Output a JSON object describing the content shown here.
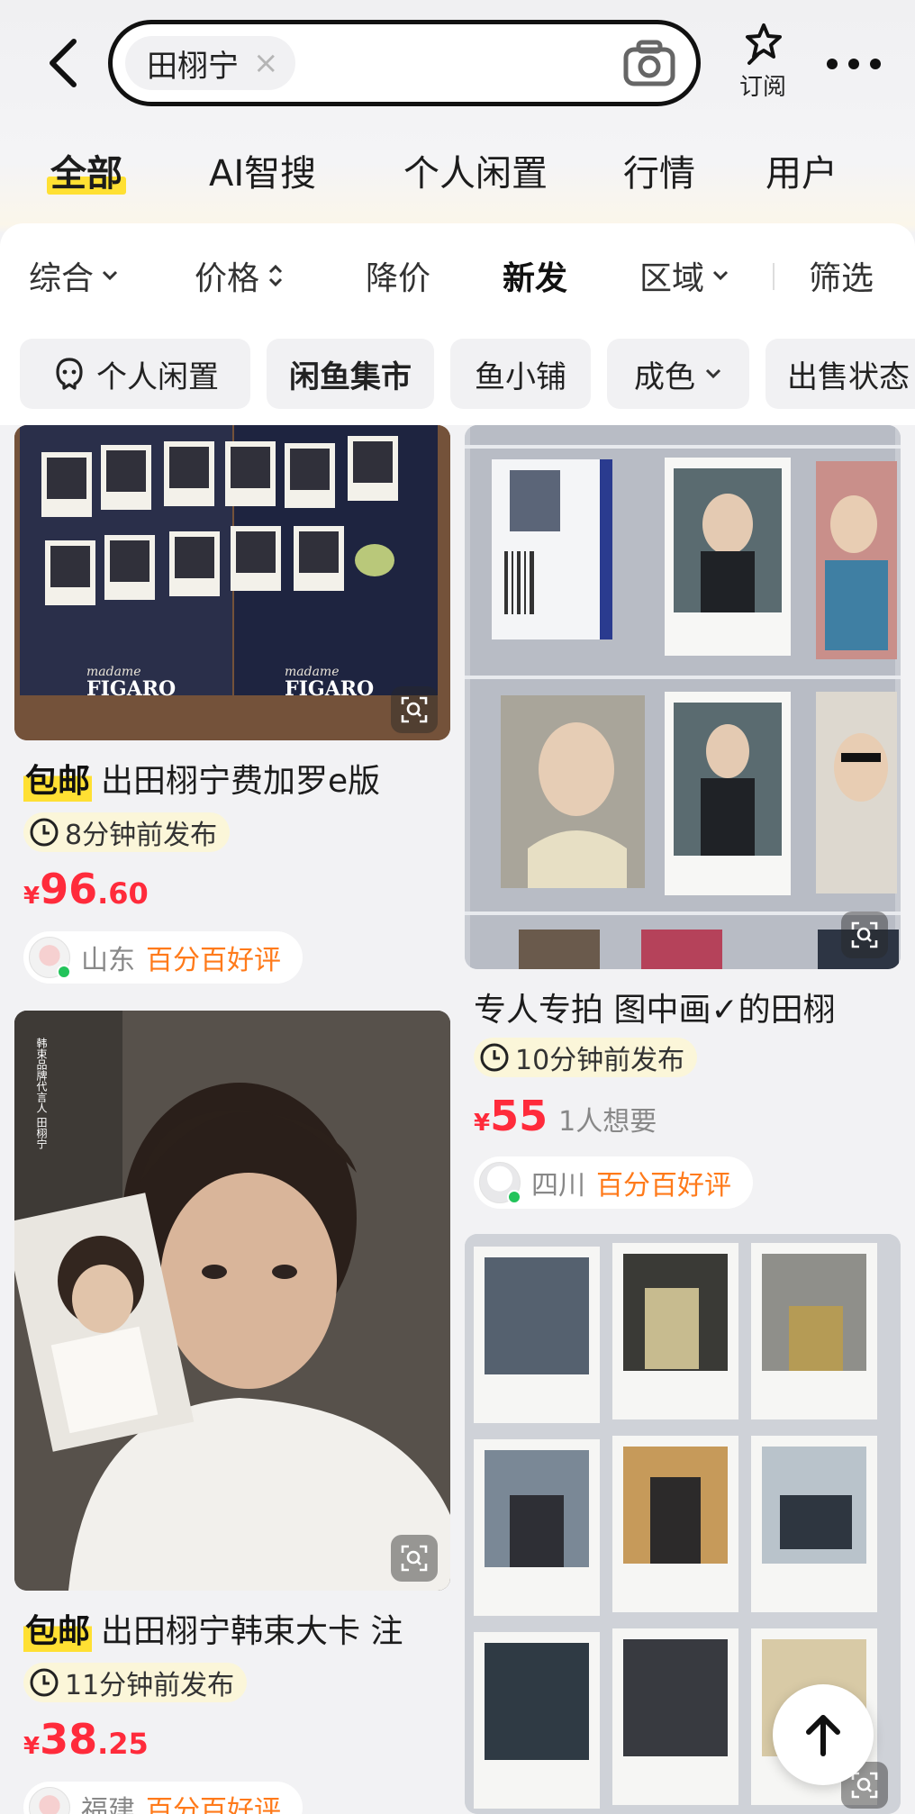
{
  "header": {
    "search_query": "田栩宁",
    "clear_symbol": "×",
    "subscribe_label": "订阅"
  },
  "tabs": [
    {
      "label": "全部",
      "active": true
    },
    {
      "label": "AI智搜"
    },
    {
      "label": "个人闲置"
    },
    {
      "label": "行情"
    },
    {
      "label": "用户"
    }
  ],
  "sort": {
    "comprehensive": "综合",
    "price": "价格",
    "price_drop": "降价",
    "newest": "新发",
    "region": "区域",
    "filter": "筛选"
  },
  "chips": {
    "personal": "个人闲置",
    "market": "闲鱼集市",
    "shop": "鱼小铺",
    "condition": "成色",
    "sale_status": "出售状态"
  },
  "items": {
    "item1": {
      "badge": "包邮",
      "title": "出田栩宁费加罗e版",
      "time": "8分钟前发布",
      "price_yen": "¥",
      "price_int": "96",
      "price_dec": ".60",
      "region": "山东",
      "rating": "百分百好评",
      "magazine_text_1": "madame",
      "magazine_text_2": "FIGARO"
    },
    "item2": {
      "title": "专人专拍 图中画✓的田栩",
      "time": "10分钟前发布",
      "price_yen": "¥",
      "price_int": "55",
      "wants": "1人想要",
      "region": "四川",
      "rating": "百分百好评"
    },
    "item3": {
      "badge": "包邮",
      "title": "出田栩宁韩束大卡 注",
      "time": "11分钟前发布",
      "price_yen": "¥",
      "price_int": "38",
      "price_dec": ".25",
      "region": "福建",
      "rating": "百分百好评",
      "poster_text": "韩束品牌代言人 田栩宁"
    }
  },
  "colors": {
    "accent_yellow": "#ffe033",
    "price_red": "#ff2b3b",
    "rating_orange": "#ff7a1a",
    "online_green": "#22c35a"
  }
}
